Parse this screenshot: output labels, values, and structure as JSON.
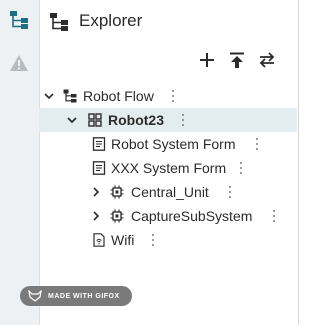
{
  "panel": {
    "title": "Explorer"
  },
  "activity_bar": {
    "items": [
      {
        "icon": "tree-icon",
        "color": "#1f6e86"
      },
      {
        "icon": "warning-icon",
        "color": "#b6bcc0"
      }
    ]
  },
  "toolbar": {
    "add_icon": "plus-icon",
    "collapse_icon": "upload-arrow-icon",
    "swap_icon": "swap-arrows-icon"
  },
  "tree": {
    "root": {
      "label": "Robot Flow"
    },
    "robot": {
      "label": "Robot23"
    },
    "children": [
      {
        "label": "Robot System Form",
        "icon": "form-icon"
      },
      {
        "label": "XXX System Form",
        "icon": "form-icon"
      },
      {
        "label": "Central_Unit",
        "icon": "chip-icon"
      },
      {
        "label": "CaptureSubSystem",
        "icon": "chip-icon"
      },
      {
        "label": "Wifi",
        "icon": "wifi-file-icon"
      }
    ]
  },
  "watermark": {
    "text": "MADE WITH GIFOX"
  },
  "colors": {
    "accent": "#1f6e86",
    "selected_row": "#e3edf0",
    "activity_bg": "#edf1f3"
  }
}
